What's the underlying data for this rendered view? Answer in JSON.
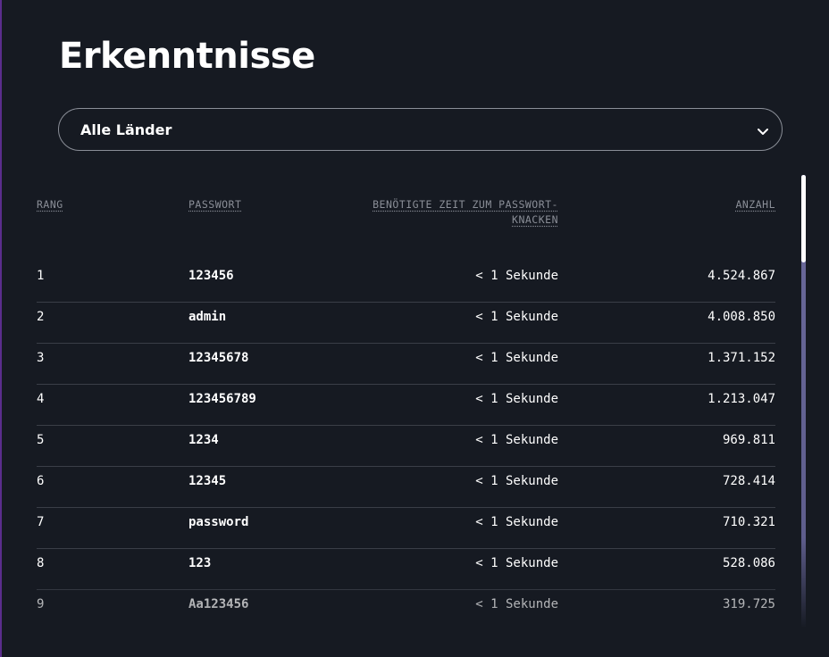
{
  "page": {
    "title": "Erkenntnisse"
  },
  "filter": {
    "selected": "Alle Länder"
  },
  "table": {
    "headers": {
      "rank": "RANG",
      "password": "PASSWORT",
      "time_line1": "BENÖTIGTE ZEIT ZUM PASSWORT-",
      "time_line2": "KNACKEN",
      "count": "ANZAHL"
    },
    "rows": [
      {
        "rank": "1",
        "password": "123456",
        "time": "< 1 Sekunde",
        "count": "4.524.867"
      },
      {
        "rank": "2",
        "password": "admin",
        "time": "< 1 Sekunde",
        "count": "4.008.850"
      },
      {
        "rank": "3",
        "password": "12345678",
        "time": "< 1 Sekunde",
        "count": "1.371.152"
      },
      {
        "rank": "4",
        "password": "123456789",
        "time": "< 1 Sekunde",
        "count": "1.213.047"
      },
      {
        "rank": "5",
        "password": "1234",
        "time": "< 1 Sekunde",
        "count": "969.811"
      },
      {
        "rank": "6",
        "password": "12345",
        "time": "< 1 Sekunde",
        "count": "728.414"
      },
      {
        "rank": "7",
        "password": "password",
        "time": "< 1 Sekunde",
        "count": "710.321"
      },
      {
        "rank": "8",
        "password": "123",
        "time": "< 1 Sekunde",
        "count": "528.086"
      },
      {
        "rank": "9",
        "password": "Aa123456",
        "time": "< 1 Sekunde",
        "count": "319.725"
      }
    ]
  },
  "icons": {
    "dropdown": "chevron-down-icon"
  },
  "colors": {
    "background": "#161a22",
    "header_text": "#8a8e97",
    "divider": "#3a3e47",
    "scrollbar": "#6b6a9c"
  }
}
